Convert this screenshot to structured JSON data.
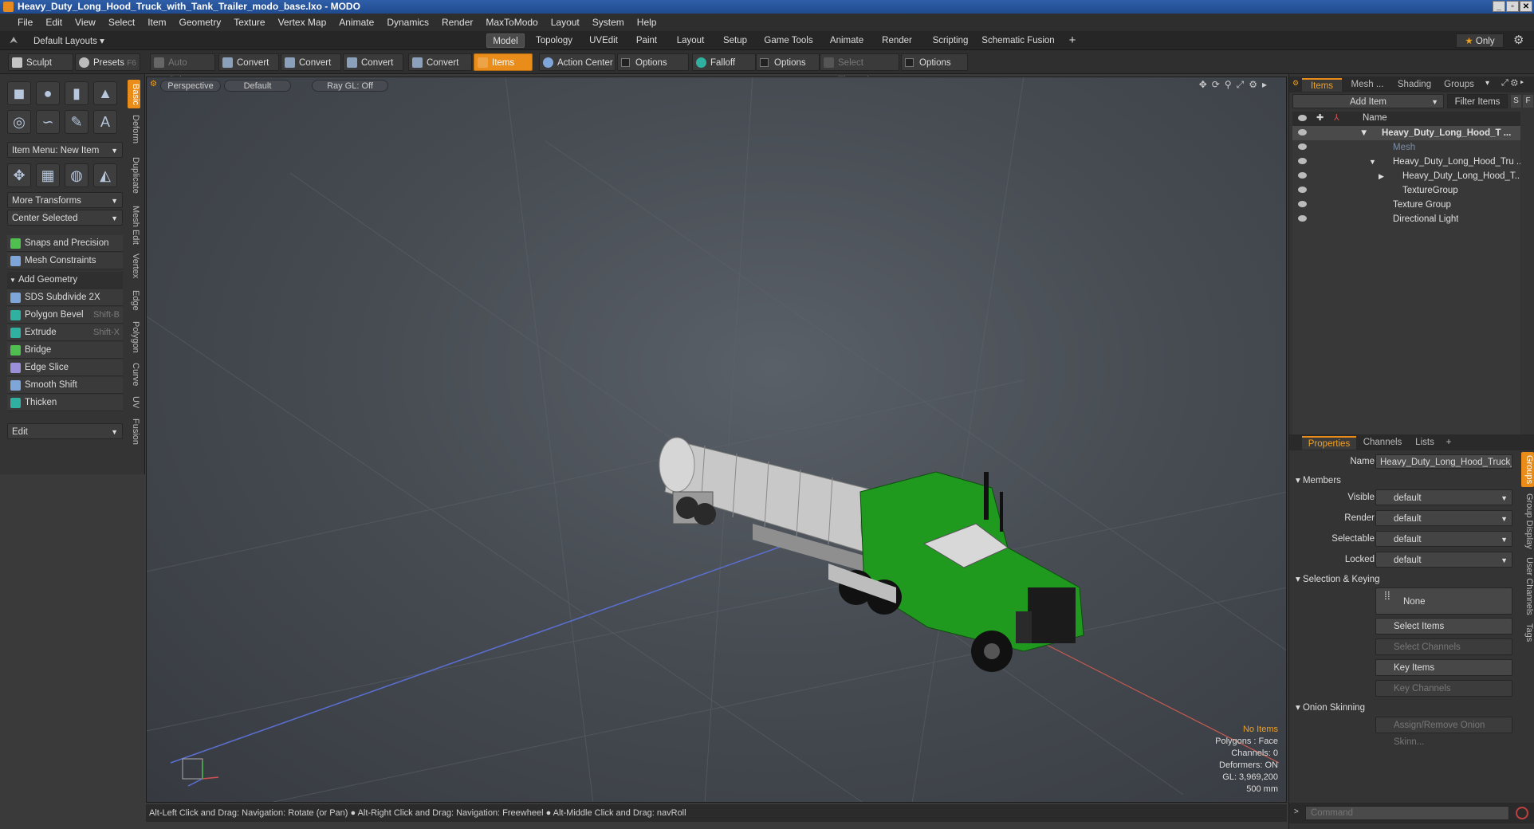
{
  "window": {
    "title": "Heavy_Duty_Long_Hood_Truck_with_Tank_Trailer_modo_base.lxo - MODO"
  },
  "menu": [
    "File",
    "Edit",
    "View",
    "Select",
    "Item",
    "Geometry",
    "Texture",
    "Vertex Map",
    "Animate",
    "Dynamics",
    "Render",
    "MaxToModo",
    "Layout",
    "System",
    "Help"
  ],
  "layoutbar": {
    "layouts_label": "Default Layouts",
    "tabs": [
      "Model",
      "Topology",
      "UVEdit",
      "Paint",
      "Layout",
      "Setup",
      "Game Tools",
      "Animate",
      "Render",
      "Scripting",
      "Schematic Fusion"
    ],
    "add_tab": "+",
    "only_label": "Only",
    "star": "★"
  },
  "toolbar": {
    "sculpt": "Sculpt",
    "presets": "Presets",
    "presets_shortcut": "F6",
    "auto_select": "Auto Select",
    "convert": "Convert",
    "items": "Items",
    "action_center": "Action Center",
    "options": "Options",
    "falloff": "Falloff",
    "select_through": "Select Through"
  },
  "leftpanel": {
    "item_menu": "Item Menu: New Item",
    "more_transforms": "More Transforms",
    "center_selected": "Center Selected",
    "snaps": "Snaps and Precision",
    "mesh_constraints": "Mesh Constraints",
    "add_geometry": "Add Geometry",
    "tools": [
      {
        "label": "SDS Subdivide 2X",
        "shortcut": ""
      },
      {
        "label": "Polygon Bevel",
        "shortcut": "Shift-B"
      },
      {
        "label": "Extrude",
        "shortcut": "Shift-X"
      },
      {
        "label": "Bridge",
        "shortcut": ""
      },
      {
        "label": "Edge Slice",
        "shortcut": ""
      },
      {
        "label": "Smooth Shift",
        "shortcut": ""
      },
      {
        "label": "Thicken",
        "shortcut": ""
      }
    ],
    "edit": "Edit",
    "vtabs": [
      "Basic",
      "Deform",
      "Duplicate",
      "Mesh Edit",
      "Vertex",
      "Edge",
      "Polygon",
      "Curve",
      "UV",
      "Fusion"
    ]
  },
  "viewport": {
    "view": "Perspective",
    "shading": "Default",
    "raygl": "Ray GL: Off",
    "info": {
      "no_items": "No Items",
      "polygons": "Polygons : Face",
      "channels": "Channels: 0",
      "deformers": "Deformers: ON",
      "gl": "GL: 3,969,200",
      "scale": "500 mm"
    }
  },
  "statusbar": "Alt-Left Click and Drag: Navigation: Rotate (or Pan) ● Alt-Right Click and Drag: Navigation: Freewheel ● Alt-Middle Click and Drag: navRoll",
  "itemlist": {
    "tabs": [
      "Items",
      "Mesh ...",
      "Shading",
      "Groups"
    ],
    "add_item": "Add Item",
    "filter_items": "Filter Items",
    "s_btn": "S",
    "f_btn": "F",
    "name_col": "Name",
    "rows": [
      {
        "label": "Heavy_Duty_Long_Hood_T ...",
        "indent": 0
      },
      {
        "label": "Mesh",
        "indent": 1
      },
      {
        "label": "Heavy_Duty_Long_Hood_Tru ...",
        "indent": 1
      },
      {
        "label": "Heavy_Duty_Long_Hood_T...",
        "indent": 2
      },
      {
        "label": "TextureGroup",
        "indent": 2
      },
      {
        "label": "Texture Group",
        "indent": 1
      },
      {
        "label": "Directional Light",
        "indent": 1
      }
    ]
  },
  "properties": {
    "tabs": [
      "Properties",
      "Channels",
      "Lists"
    ],
    "add_tab": "+",
    "name_label": "Name",
    "name_value": "Heavy_Duty_Long_Hood_Truck_w",
    "members": "Members",
    "visible_label": "Visible",
    "render_label": "Render",
    "selectable_label": "Selectable",
    "locked_label": "Locked",
    "default": "default",
    "selection_keying": "Selection & Keying",
    "none": "None",
    "select_items": "Select Items",
    "select_channels": "Select Channels",
    "key_items": "Key Items",
    "key_channels": "Key Channels",
    "onion": "Onion Skinning",
    "assign_onion": "Assign/Remove Onion Skinn...",
    "side_tabs": [
      "Groups",
      "Group Display",
      "User Channels",
      "Tags"
    ]
  },
  "command": {
    "placeholder": "Command"
  },
  "colors": {
    "accent": "#e98c1a",
    "truck": "#1f9a1f"
  }
}
